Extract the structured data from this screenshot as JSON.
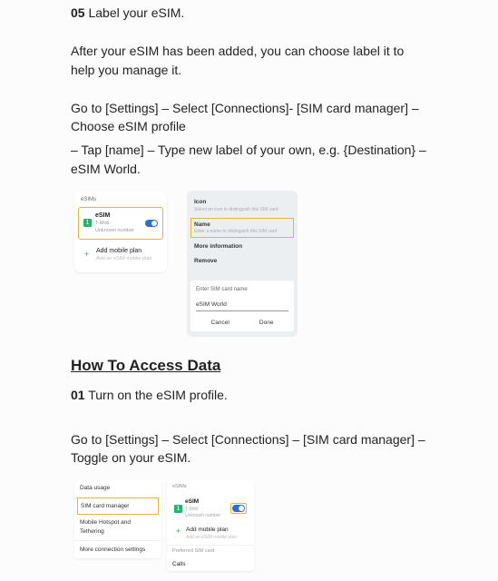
{
  "step05": {
    "num": "05",
    "text": "Label your eSIM."
  },
  "p1": "After your eSIM has been added, you can choose label it to help you manage it.",
  "p2": "Go to [Settings] – Select [Connections]- [SIM card manager] – Choose eSIM profile",
  "p3": "– Tap [name] – Type new label of your own, e.g. {Destination} – eSIM World.",
  "fig1": {
    "panelA": {
      "header": "eSIMs",
      "esim": {
        "badge": "1",
        "label": "eSIM",
        "sub1": "T-Mob",
        "sub2": "Unknown number",
        "toggleOn": true
      },
      "add": {
        "label": "Add mobile plan",
        "sub": "Add an eSIM mobile plan"
      }
    },
    "panelB": {
      "iconTitle": "Icon",
      "iconSub": "Select an icon to distinguish this SIM card",
      "nameTitle": "Name",
      "nameSub": "Enter a name to distinguish this SIM card",
      "moreInfo": "More information",
      "remove": "Remove",
      "enterLabel": "Enter SIM card name",
      "inputValue": "eSIM World",
      "cancel": "Cancel",
      "done": "Done"
    }
  },
  "sectionHeading": "How To Access Data",
  "step01": {
    "num": "01",
    "text": "Turn on the eSIM profile."
  },
  "p4": "Go to [Settings] – Select [Connections] – [SIM card manager] – Toggle on your eSIM.",
  "fig2": {
    "panelC": {
      "r1": "Data usage",
      "r2": "SIM card manager",
      "r3": "Mobile Hotspot and Tethering",
      "r4": "More connection settings"
    },
    "panelD": {
      "header": "eSIMs",
      "esim": {
        "badge": "1",
        "label": "eSIM",
        "sub1": "T-Mob",
        "sub2": "Unknown number"
      },
      "add": {
        "label": "Add mobile plan",
        "sub": "Add an eSIM mobile plan"
      },
      "prefHeader": "Preferred SIM card",
      "calls": "Calls"
    }
  }
}
